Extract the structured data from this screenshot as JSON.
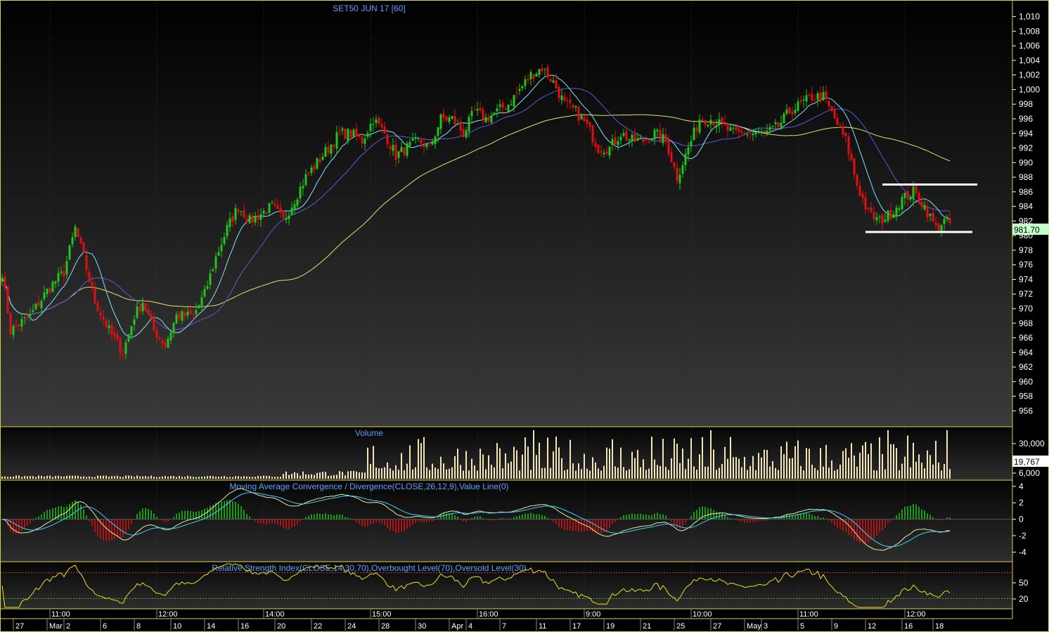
{
  "chart_data": [
    {
      "type": "candlestick",
      "title": "SET50 JUN 17   [60]",
      "ylim": [
        954.5,
        1011.5
      ],
      "y_ticks": [
        956,
        958,
        960,
        962,
        964,
        966,
        968,
        970,
        972,
        974,
        976,
        978,
        980,
        982,
        984,
        986,
        988,
        990,
        992,
        994,
        996,
        998,
        "1,000",
        "1,002",
        "1,004",
        "1,006",
        "1,008",
        "1,010"
      ],
      "last_price": "981.70",
      "close_path": [
        {
          "bar": 0,
          "close": 975
        },
        {
          "bar": 3,
          "close": 967
        },
        {
          "bar": 10,
          "close": 969
        },
        {
          "bar": 17,
          "close": 973
        },
        {
          "bar": 22,
          "close": 975
        },
        {
          "bar": 26,
          "close": 981
        },
        {
          "bar": 29,
          "close": 977
        },
        {
          "bar": 33,
          "close": 971
        },
        {
          "bar": 38,
          "close": 967
        },
        {
          "bar": 43,
          "close": 964
        },
        {
          "bar": 47,
          "close": 969
        },
        {
          "bar": 50,
          "close": 971
        },
        {
          "bar": 54,
          "close": 967
        },
        {
          "bar": 58,
          "close": 965
        },
        {
          "bar": 62,
          "close": 969
        },
        {
          "bar": 68,
          "close": 969
        },
        {
          "bar": 72,
          "close": 972
        },
        {
          "bar": 76,
          "close": 977
        },
        {
          "bar": 80,
          "close": 981
        },
        {
          "bar": 84,
          "close": 984
        },
        {
          "bar": 88,
          "close": 982
        },
        {
          "bar": 92,
          "close": 983
        },
        {
          "bar": 96,
          "close": 984
        },
        {
          "bar": 100,
          "close": 982
        },
        {
          "bar": 104,
          "close": 985
        },
        {
          "bar": 108,
          "close": 988
        },
        {
          "bar": 112,
          "close": 990
        },
        {
          "bar": 116,
          "close": 992
        },
        {
          "bar": 120,
          "close": 994
        },
        {
          "bar": 124,
          "close": 994
        },
        {
          "bar": 128,
          "close": 993
        },
        {
          "bar": 132,
          "close": 996
        },
        {
          "bar": 136,
          "close": 994
        },
        {
          "bar": 140,
          "close": 991
        },
        {
          "bar": 144,
          "close": 992
        },
        {
          "bar": 148,
          "close": 993
        },
        {
          "bar": 152,
          "close": 992
        },
        {
          "bar": 156,
          "close": 996
        },
        {
          "bar": 160,
          "close": 996
        },
        {
          "bar": 164,
          "close": 994
        },
        {
          "bar": 168,
          "close": 997
        },
        {
          "bar": 172,
          "close": 996
        },
        {
          "bar": 176,
          "close": 997
        },
        {
          "bar": 180,
          "close": 998
        },
        {
          "bar": 184,
          "close": 1000
        },
        {
          "bar": 188,
          "close": 1002
        },
        {
          "bar": 192,
          "close": 1003
        },
        {
          "bar": 196,
          "close": 1001
        },
        {
          "bar": 200,
          "close": 998
        },
        {
          "bar": 204,
          "close": 997
        },
        {
          "bar": 208,
          "close": 995
        },
        {
          "bar": 212,
          "close": 992
        },
        {
          "bar": 216,
          "close": 992
        },
        {
          "bar": 220,
          "close": 994
        },
        {
          "bar": 224,
          "close": 993
        },
        {
          "bar": 228,
          "close": 993
        },
        {
          "bar": 232,
          "close": 994
        },
        {
          "bar": 236,
          "close": 993
        },
        {
          "bar": 240,
          "close": 988
        },
        {
          "bar": 244,
          "close": 992
        },
        {
          "bar": 248,
          "close": 996
        },
        {
          "bar": 252,
          "close": 996
        },
        {
          "bar": 256,
          "close": 995
        },
        {
          "bar": 260,
          "close": 994
        },
        {
          "bar": 264,
          "close": 994
        },
        {
          "bar": 268,
          "close": 994
        },
        {
          "bar": 272,
          "close": 994
        },
        {
          "bar": 276,
          "close": 995
        },
        {
          "bar": 280,
          "close": 997
        },
        {
          "bar": 284,
          "close": 998
        },
        {
          "bar": 288,
          "close": 999
        },
        {
          "bar": 292,
          "close": 999
        },
        {
          "bar": 296,
          "close": 996
        },
        {
          "bar": 300,
          "close": 993
        },
        {
          "bar": 304,
          "close": 987
        },
        {
          "bar": 308,
          "close": 983
        },
        {
          "bar": 312,
          "close": 982
        },
        {
          "bar": 316,
          "close": 983
        },
        {
          "bar": 320,
          "close": 985
        },
        {
          "bar": 324,
          "close": 986
        },
        {
          "bar": 328,
          "close": 984
        },
        {
          "bar": 332,
          "close": 981
        },
        {
          "bar": 335,
          "close": 982
        },
        {
          "bar": 337,
          "close": 981.7
        }
      ],
      "horizontal_levels": [
        987,
        980.5
      ]
    },
    {
      "type": "bar",
      "title": "Volume",
      "y_ticks": [
        "30,000",
        "6,000"
      ],
      "last_value": "19,767"
    },
    {
      "type": "line",
      "title": "Moving Average Convergence / Divergence(CLOSE,26,12,9),Value Line(0)",
      "y_ticks": [
        "4",
        "2",
        "0",
        "-2",
        "-4"
      ],
      "ylim": [
        -5,
        4.5
      ]
    },
    {
      "type": "line",
      "title": "Relative Strength Index(CLOSE,14,30,70),Overbought Level(70),Oversold Level(30)",
      "y_ticks": [
        "50",
        "20"
      ],
      "levels": [
        70,
        30
      ]
    }
  ],
  "x_labels": [
    {
      "bar": 4,
      "text": "27"
    },
    {
      "bar": 16,
      "text": "Mar"
    },
    {
      "bar": 22,
      "text": "2"
    },
    {
      "bar": 35,
      "text": "6"
    },
    {
      "bar": 47,
      "text": "8"
    },
    {
      "bar": 60,
      "text": "10"
    },
    {
      "bar": 72,
      "text": "14"
    },
    {
      "bar": 84,
      "text": "16"
    },
    {
      "bar": 97,
      "text": "20"
    },
    {
      "bar": 110,
      "text": "22"
    },
    {
      "bar": 122,
      "text": "24"
    },
    {
      "bar": 134,
      "text": "28"
    },
    {
      "bar": 147,
      "text": "30"
    },
    {
      "bar": 159,
      "text": "Apr"
    },
    {
      "bar": 165,
      "text": "4"
    },
    {
      "bar": 177,
      "text": "7"
    },
    {
      "bar": 190,
      "text": "11"
    },
    {
      "bar": 202,
      "text": "17"
    },
    {
      "bar": 214,
      "text": "19"
    },
    {
      "bar": 227,
      "text": "21"
    },
    {
      "bar": 239,
      "text": "25"
    },
    {
      "bar": 252,
      "text": "27"
    },
    {
      "bar": 264,
      "text": "May"
    },
    {
      "bar": 270,
      "text": "3"
    },
    {
      "bar": 283,
      "text": "5"
    },
    {
      "bar": 295,
      "text": "9"
    },
    {
      "bar": 307,
      "text": "12"
    },
    {
      "bar": 320,
      "text": "16"
    },
    {
      "bar": 331,
      "text": "18"
    }
  ],
  "time_labels": [
    {
      "bar": 17,
      "text": "11:00"
    },
    {
      "bar": 55,
      "text": "12:00"
    },
    {
      "bar": 93,
      "text": "14:00"
    },
    {
      "bar": 131,
      "text": "15:00"
    },
    {
      "bar": 169,
      "text": "16:00"
    },
    {
      "bar": 207,
      "text": "9:00"
    },
    {
      "bar": 245,
      "text": "10:00"
    },
    {
      "bar": 283,
      "text": "11:00"
    },
    {
      "bar": 321,
      "text": "12:00"
    }
  ],
  "colors": {
    "up": "#22c41e",
    "down": "#e01010",
    "sma_short": "#7fe6ff",
    "sma_mid": "#5b5bd6",
    "sma_long": "#e6e070",
    "volume": "#f2e6b8",
    "grid": "#3a3a3a",
    "separator": "#d8d040",
    "macd_line": "#e8e8a0",
    "signal_line": "#3fd0ff",
    "rsi_line": "#e8e020",
    "overbought": "#d04040",
    "oversold": "#40c040",
    "tag_bg": "#c8ffc8",
    "axis_text": "#ffffff",
    "title_text": "#5aa0ff"
  }
}
